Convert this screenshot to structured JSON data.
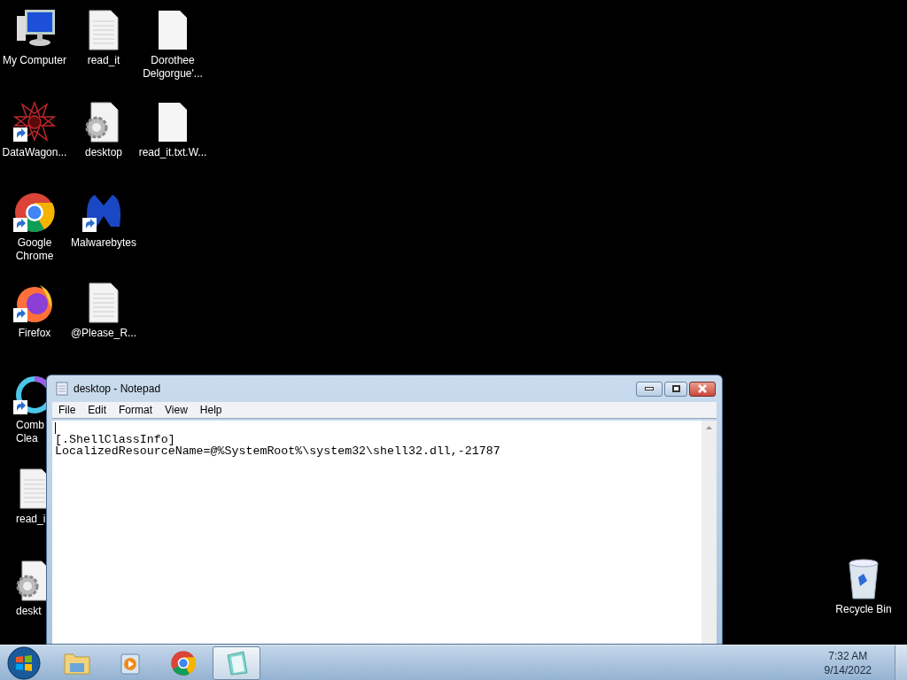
{
  "desktop_icons": [
    {
      "label": "My Computer",
      "kind": "computer",
      "shortcut": false
    },
    {
      "label": "read_it",
      "kind": "textfile",
      "shortcut": false
    },
    {
      "label": "Dorothee Delgorgue'...",
      "kind": "blankfile",
      "shortcut": false
    },
    {
      "label": "DataWagon...",
      "kind": "star",
      "shortcut": true
    },
    {
      "label": "desktop",
      "kind": "settingsfile",
      "shortcut": false
    },
    {
      "label": "read_it.txt.W...",
      "kind": "blankfile",
      "shortcut": false
    },
    {
      "label": "Google Chrome",
      "kind": "chrome",
      "shortcut": true
    },
    {
      "label": "Malwarebytes",
      "kind": "malware",
      "shortcut": true
    },
    {
      "label": "Firefox",
      "kind": "firefox",
      "shortcut": true
    },
    {
      "label": "@Please_R...",
      "kind": "textfile",
      "shortcut": false
    },
    {
      "label": "Comb Clea",
      "kind": "ring",
      "shortcut": true
    },
    {
      "label": "read_i",
      "kind": "textfile",
      "shortcut": false
    },
    {
      "label": "deskt",
      "kind": "settingsfile",
      "shortcut": false
    },
    {
      "label": "Recycle Bin",
      "kind": "recycle",
      "shortcut": false
    }
  ],
  "notepad": {
    "title": "desktop - Notepad",
    "menu": [
      "File",
      "Edit",
      "Format",
      "View",
      "Help"
    ],
    "cursor": true,
    "lines": [
      "[.ShellClassInfo]",
      "LocalizedResourceName=@%SystemRoot%\\system32\\shell32.dll,-21787"
    ]
  },
  "taskbar": {
    "items": [
      {
        "kind": "explorer",
        "selected": false
      },
      {
        "kind": "media",
        "selected": false
      },
      {
        "kind": "chrome",
        "selected": false
      },
      {
        "kind": "notepad",
        "selected": true
      }
    ],
    "time": "7:32 AM",
    "date": "9/14/2022"
  }
}
